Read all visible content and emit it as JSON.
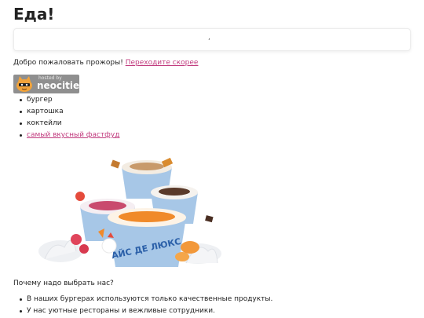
{
  "header": {
    "title": "Еда!"
  },
  "banner": {
    "text": ","
  },
  "welcome": {
    "text": "Добро пожаловать прожоры! ",
    "link": "Переходите скорее"
  },
  "badge": {
    "hosted_by": "hosted by",
    "brand": "neocities"
  },
  "menu": {
    "items": [
      "бургер",
      "картошка",
      "коктейли"
    ],
    "link_item": "самый вкусный фастфуд"
  },
  "image": {
    "cup_text": "АЙС ДЕ ЛЮКС"
  },
  "why": {
    "question": "Почему надо выбрать нас?",
    "reasons": [
      "В наших бургерах используются только качественные продукты.",
      "У нас уютные рестораны и вежливые сотрудники."
    ]
  },
  "colors": {
    "link": "#c13b7e",
    "badge_bg": "#8f8f8f",
    "cup_blue": "#a7c7e7",
    "cup_text": "#2a5fa8"
  }
}
